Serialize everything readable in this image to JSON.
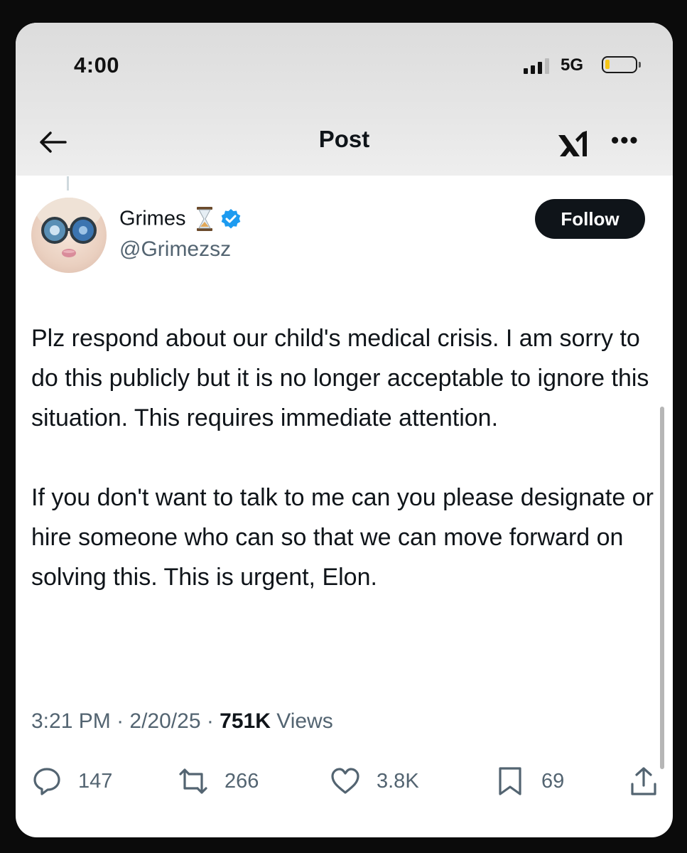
{
  "status_bar": {
    "time": "4:00",
    "network": "5G",
    "battery_level": 0.15,
    "battery_color": "#f5c518"
  },
  "header": {
    "title": "Post",
    "back_icon": "arrow-left-icon",
    "grok_icon": "grok-logo-icon",
    "more_icon": "more-horizontal-icon",
    "more_label": "•••"
  },
  "author": {
    "display_name": "Grimes",
    "emoji": "⏳",
    "verified_color": "#1d9bf0",
    "handle": "@Grimezsz",
    "follow_label": "Follow"
  },
  "post": {
    "paragraphs": [
      "Plz respond about our child's medical crisis.  I am sorry to do this publicly but it is no longer acceptable to ignore this situation.  This requires immediate attention.",
      "If you don't want to talk to me can you please designate or hire someone who can so that we can move forward on solving this.   This is urgent, Elon."
    ],
    "time": "3:21 PM",
    "date": "2/20/25",
    "separator": " · ",
    "views_count": "751K",
    "views_label": "Views"
  },
  "actions": {
    "replies": "147",
    "reposts": "266",
    "likes": "3.8K",
    "bookmarks": "69"
  }
}
